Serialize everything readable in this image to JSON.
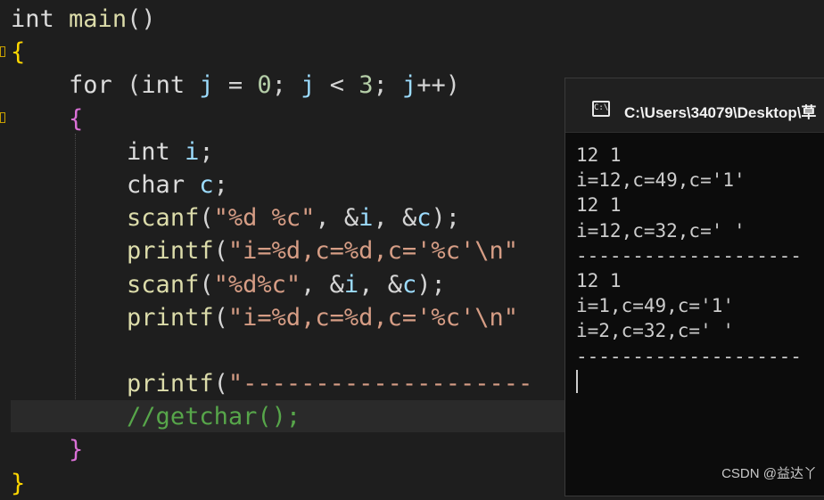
{
  "editor": {
    "lines": [
      {
        "indent": "",
        "tokens": [
          [
            "kw",
            "int"
          ],
          [
            "pn",
            " "
          ],
          [
            "fn",
            "main"
          ],
          [
            "pn",
            "()"
          ]
        ]
      },
      {
        "indent": "",
        "tokens": [
          [
            "br1",
            "{"
          ]
        ]
      },
      {
        "indent": "    ",
        "tokens": [
          [
            "kw",
            "for"
          ],
          [
            "pn",
            " ("
          ],
          [
            "kw",
            "int"
          ],
          [
            "pn",
            " "
          ],
          [
            "id",
            "j"
          ],
          [
            "pn",
            " = "
          ],
          [
            "num",
            "0"
          ],
          [
            "pn",
            "; "
          ],
          [
            "id",
            "j"
          ],
          [
            "pn",
            " < "
          ],
          [
            "num",
            "3"
          ],
          [
            "pn",
            "; "
          ],
          [
            "id",
            "j"
          ],
          [
            "pn",
            "++)"
          ]
        ]
      },
      {
        "indent": "    ",
        "tokens": [
          [
            "br2",
            "{"
          ]
        ]
      },
      {
        "indent": "        ",
        "tokens": [
          [
            "kw",
            "int"
          ],
          [
            "pn",
            " "
          ],
          [
            "id",
            "i"
          ],
          [
            "pn",
            ";"
          ]
        ]
      },
      {
        "indent": "        ",
        "tokens": [
          [
            "kw",
            "char"
          ],
          [
            "pn",
            " "
          ],
          [
            "id",
            "c"
          ],
          [
            "pn",
            ";"
          ]
        ]
      },
      {
        "indent": "        ",
        "tokens": [
          [
            "fn",
            "scanf"
          ],
          [
            "pn",
            "("
          ],
          [
            "str",
            "\"%d %c\""
          ],
          [
            "pn",
            ", &"
          ],
          [
            "id",
            "i"
          ],
          [
            "pn",
            ", &"
          ],
          [
            "id",
            "c"
          ],
          [
            "pn",
            ");"
          ]
        ]
      },
      {
        "indent": "        ",
        "tokens": [
          [
            "fn",
            "printf"
          ],
          [
            "pn",
            "("
          ],
          [
            "str",
            "\"i=%d,c=%d,c='%c'\\n\""
          ]
        ]
      },
      {
        "indent": "        ",
        "tokens": [
          [
            "fn",
            "scanf"
          ],
          [
            "pn",
            "("
          ],
          [
            "str",
            "\"%d%c\""
          ],
          [
            "pn",
            ", &"
          ],
          [
            "id",
            "i"
          ],
          [
            "pn",
            ", &"
          ],
          [
            "id",
            "c"
          ],
          [
            "pn",
            ");"
          ]
        ]
      },
      {
        "indent": "        ",
        "tokens": [
          [
            "fn",
            "printf"
          ],
          [
            "pn",
            "("
          ],
          [
            "str",
            "\"i=%d,c=%d,c='%c'\\n\""
          ]
        ]
      },
      {
        "indent": "",
        "tokens": []
      },
      {
        "indent": "        ",
        "tokens": [
          [
            "fn",
            "printf"
          ],
          [
            "pn",
            "("
          ],
          [
            "str",
            "\"--------------------"
          ]
        ]
      },
      {
        "indent": "        ",
        "tokens": [
          [
            "cm",
            "//getchar();"
          ]
        ]
      },
      {
        "indent": "    ",
        "tokens": [
          [
            "br2",
            "}"
          ]
        ]
      },
      {
        "indent": "",
        "tokens": [
          [
            "br1",
            "}"
          ]
        ]
      }
    ]
  },
  "console": {
    "icon": "cmd-icon",
    "title": "C:\\Users\\34079\\Desktop\\草",
    "output": "12 1\ni=12,c=49,c='1'\n12 1\ni=12,c=32,c=' '\n--------------------\n12 1\ni=1,c=49,c='1'\ni=2,c=32,c=' '\n--------------------"
  },
  "watermark": "CSDN @益达丫"
}
